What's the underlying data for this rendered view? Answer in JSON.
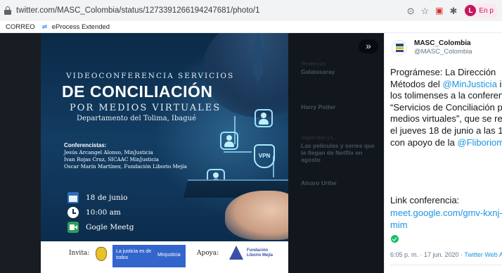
{
  "browser": {
    "url": "twitter.com/MASC_Colombia/status/1273391266194247681/photo/1",
    "profile_initial": "L",
    "profile_label": "En p",
    "bookmarks": [
      {
        "label": "CORREO"
      },
      {
        "label": "eProcess Extended"
      }
    ]
  },
  "media": {
    "expand_label": "»",
    "background_items": [
      {
        "label": "Tendencias",
        "value": "Galatasaray"
      },
      {
        "label": "",
        "value": "Harry Potter"
      },
      {
        "label": "Vogue Mex y L...",
        "value": "Las películas y series que te llegan de Netflix en agosto"
      },
      {
        "label": "",
        "value": "Alvaro Uribe"
      }
    ]
  },
  "poster": {
    "title_line1": "VIDEOCONFERENCIA SERVICIOS",
    "title_line2": "DE CONCILIACIÓN",
    "title_line3": "POR MEDIOS VIRTUALES",
    "title_line4": "Departamento del Tolima, Ibagué",
    "vpn_label": "VPN",
    "speakers_heading": "Conferencistas:",
    "speakers": [
      "Jesús Arcangel Alonso, MinJusticia",
      "Ivan Rojas Cruz, SICAAC MinJusticia",
      "Oscar Marín Martínez, Fundación Liborio Mejía"
    ],
    "date": "18 de junio",
    "time": "10:00 am",
    "platform": "Gogle Meetg",
    "footer": {
      "invita_label": "Invita:",
      "gov_text": "La justicia es de todos",
      "gov_sub": "Minjusticia",
      "apoya_label": "Apoya:",
      "fund_line1": "Fundación",
      "fund_line2": "Liborio Mejía"
    }
  },
  "tweet": {
    "display_name": "MASC_Colombia",
    "handle": "@MASC_Colombia",
    "body_parts": [
      {
        "text": "Prográmese: La Dirección Métodos del ",
        "link": false
      },
      {
        "text": "@MinJusticia",
        "link": true
      },
      {
        "text": " invita a los tolimenses a la conferencia “Servicios de Conciliación por medios virtuales”, que se realizará el jueves 18 de junio a las 10 a.m con apoyo de la ",
        "link": false
      },
      {
        "text": "@Fliboriomejia",
        "link": true
      }
    ],
    "link_label": "Link conferencia:",
    "link_url": "meet.google.com/gmv-kxnj-mim",
    "timestamp": "6:05 p. m. · 17 jun. 2020 · ",
    "source": "Twitter Web App",
    "accent_color": "#1b95e0"
  }
}
